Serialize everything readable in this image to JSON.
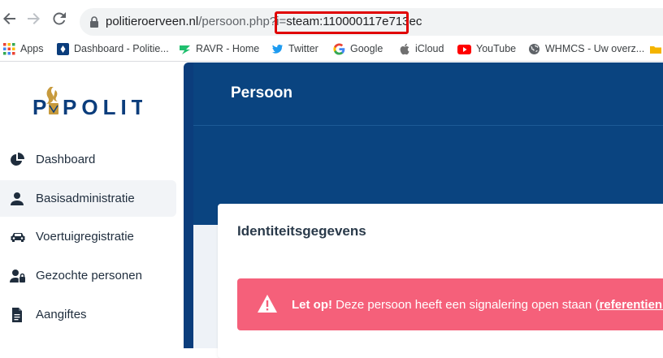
{
  "browser": {
    "url_host": "politieroerveen.nl",
    "url_path": "/persoon.php?i=",
    "url_query_value": "steam:110000117e713ec"
  },
  "bookmarks": [
    {
      "label": "Apps",
      "icon": "apps-grid-icon"
    },
    {
      "label": "Dashboard - Politie...",
      "icon": "police-badge-icon"
    },
    {
      "label": "RAVR - Home",
      "icon": "ravr-logo-icon"
    },
    {
      "label": "Twitter",
      "icon": "twitter-icon"
    },
    {
      "label": "Google",
      "icon": "google-icon"
    },
    {
      "label": "iCloud",
      "icon": "apple-icon"
    },
    {
      "label": "YouTube",
      "icon": "youtube-icon"
    },
    {
      "label": "WHMCS - Uw overz...",
      "icon": "globe-icon"
    }
  ],
  "logo": {
    "text": "POLITIE"
  },
  "sidebar": {
    "items": [
      {
        "label": "Dashboard",
        "icon": "pie-chart-icon"
      },
      {
        "label": "Basisadministratie",
        "icon": "user-icon"
      },
      {
        "label": "Voertuigregistratie",
        "icon": "car-icon"
      },
      {
        "label": "Gezochte personen",
        "icon": "user-lock-icon"
      },
      {
        "label": "Aangiftes",
        "icon": "document-icon"
      }
    ]
  },
  "header": {
    "title": "Persoon"
  },
  "card": {
    "title": "Identiteitsgegevens"
  },
  "alert": {
    "strong": "Let op!",
    "message": " Deze persoon heeft een signalering open staan (",
    "link": "referentienum"
  },
  "colors": {
    "header": "#0a4480",
    "alert": "#f5607a",
    "highlight": "#e00000"
  }
}
